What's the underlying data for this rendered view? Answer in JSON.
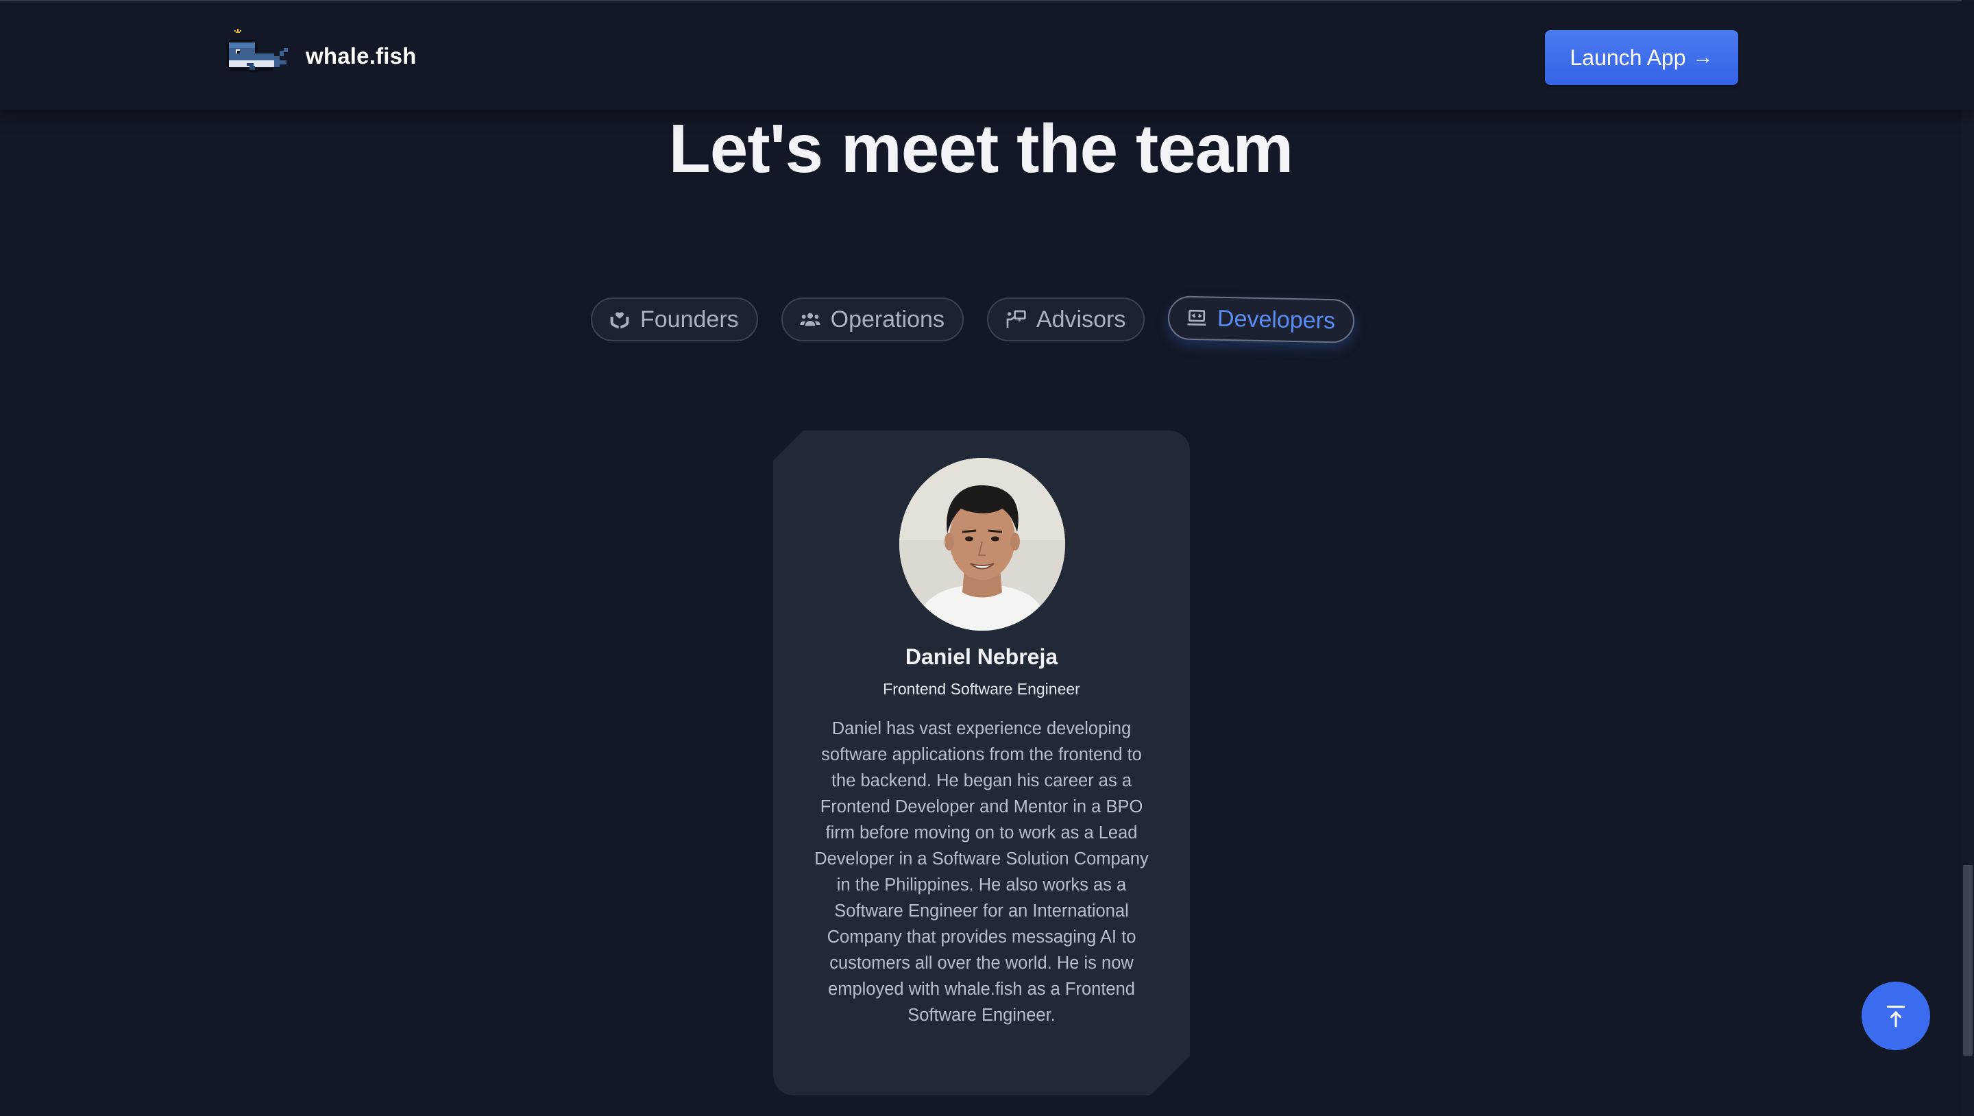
{
  "header": {
    "brand_name": "whale.fish",
    "launch_label": "Launch App",
    "launch_arrow": "→"
  },
  "main": {
    "title": "Let's meet the team",
    "tabs": [
      {
        "label": "Founders",
        "icon": "hands-heart-icon",
        "active": false
      },
      {
        "label": "Operations",
        "icon": "users-group-icon",
        "active": false
      },
      {
        "label": "Advisors",
        "icon": "presentation-icon",
        "active": false
      },
      {
        "label": "Developers",
        "icon": "laptop-code-icon",
        "active": true
      }
    ],
    "member": {
      "name": "Daniel Nebreja",
      "role": "Frontend Software Engineer",
      "bio": "Daniel has vast experience developing software applications from the frontend to the backend. He began his career as a Frontend Developer and Mentor in a BPO firm before moving on to work as a Lead Developer in a Software Solution Company in the Philippines. He also works as a Software Engineer for an International Company that provides messaging AI to customers all over the world. He is now employed with whale.fish as a Frontend Software Engineer."
    }
  },
  "colors": {
    "background": "#121826",
    "card": "#212836",
    "accent": "#3b6cf0",
    "active_tab_text": "#5b8cf5"
  }
}
